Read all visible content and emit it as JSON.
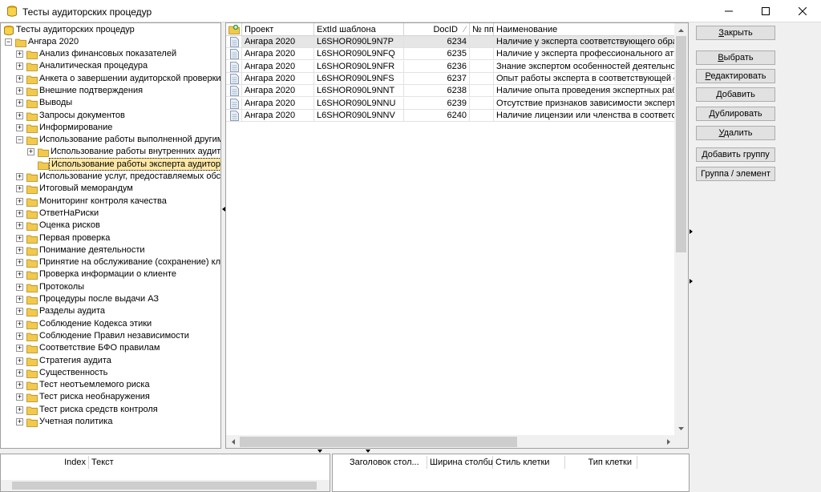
{
  "window": {
    "title": "Тесты аудиторских процедур",
    "icon": "database-icon",
    "controls": [
      "minimize-icon",
      "maximize-icon",
      "close-icon"
    ]
  },
  "tree": {
    "root": "Тесты аудиторских процедур",
    "project": "Ангара 2020",
    "nodes": [
      {
        "label": "Анализ финансовых показателей",
        "expander": "+"
      },
      {
        "label": "Аналитическая процедура",
        "expander": "+"
      },
      {
        "label": "Анкета о завершении аудиторской проверки",
        "expander": "+"
      },
      {
        "label": "Внешние подтверждения",
        "expander": "+"
      },
      {
        "label": "Выводы",
        "expander": "+"
      },
      {
        "label": "Запросы документов",
        "expander": "+"
      },
      {
        "label": "Информирование",
        "expander": "+"
      },
      {
        "label": "Использование работы выполненной другими",
        "expander": "−"
      },
      {
        "label": "Использование работы внутренних аудито...",
        "expander": "+",
        "child": true
      },
      {
        "label": "Использование работы эксперта аудитора",
        "expander": "",
        "child": true,
        "selected": true
      },
      {
        "label": "Использование услуг, предоставляемых обслу...",
        "expander": "+"
      },
      {
        "label": "Итоговый меморандум",
        "expander": "+"
      },
      {
        "label": "Мониторинг контроля качества",
        "expander": "+"
      },
      {
        "label": "ОтветНаРиски",
        "expander": "+"
      },
      {
        "label": "Оценка рисков",
        "expander": "+"
      },
      {
        "label": "Первая проверка",
        "expander": "+"
      },
      {
        "label": "Понимание деятельности",
        "expander": "+"
      },
      {
        "label": "Принятие на обслуживание (сохранение) клие...",
        "expander": "+"
      },
      {
        "label": "Проверка информации о клиенте",
        "expander": "+"
      },
      {
        "label": "Протоколы",
        "expander": "+"
      },
      {
        "label": "Процедуры после выдачи АЗ",
        "expander": "+"
      },
      {
        "label": "Разделы аудита",
        "expander": "+"
      },
      {
        "label": "Соблюдение Кодекса этики",
        "expander": "+"
      },
      {
        "label": "Соблюдение Правил независимости",
        "expander": "+"
      },
      {
        "label": "Соответствие БФО правилам",
        "expander": "+"
      },
      {
        "label": "Стратегия аудита",
        "expander": "+"
      },
      {
        "label": "Существенность",
        "expander": "+"
      },
      {
        "label": "Тест неотъемлемого риска",
        "expander": "+"
      },
      {
        "label": "Тест риска необнаружения",
        "expander": "+"
      },
      {
        "label": "Тест риска средств контроля",
        "expander": "+"
      },
      {
        "label": "Учетная политика",
        "expander": "+"
      }
    ]
  },
  "grid": {
    "columns": [
      "Проект",
      "ExtId шаблона",
      "DocID",
      "№ пп",
      "Наименование"
    ],
    "rows": [
      {
        "project": "Ангара 2020",
        "extid": "L6SHOR090L9N7P",
        "docid": "6234",
        "pp": "",
        "name": "Наличие у эксперта соответствующего образо..."
      },
      {
        "project": "Ангара 2020",
        "extid": "L6SHOR090L9NFQ",
        "docid": "6235",
        "pp": "",
        "name": "Наличие у эксперта профессионального аттес..."
      },
      {
        "project": "Ангара 2020",
        "extid": "L6SHOR090L9NFR",
        "docid": "6236",
        "pp": "",
        "name": "Знание экспертом особенностей деятельности ..."
      },
      {
        "project": "Ангара 2020",
        "extid": "L6SHOR090L9NFS",
        "docid": "6237",
        "pp": "",
        "name": "Опыт работы эксперта в соответствующей от..."
      },
      {
        "project": "Ангара 2020",
        "extid": "L6SHOR090L9NNT",
        "docid": "6238",
        "pp": "",
        "name": "Наличие опыта проведения экспертных работ ..."
      },
      {
        "project": "Ангара 2020",
        "extid": "L6SHOR090L9NNU",
        "docid": "6239",
        "pp": "",
        "name": "Отсутствие признаков зависимости эксперта о..."
      },
      {
        "project": "Ангара 2020",
        "extid": "L6SHOR090L9NNV",
        "docid": "6240",
        "pp": "",
        "name": "Наличие лицензии или членства в соответству..."
      }
    ]
  },
  "buttons": [
    {
      "label": "Закрыть",
      "key": "З",
      "rest": "акрыть"
    },
    {
      "label": "Выбрать",
      "key": "В",
      "rest": "ыбрать"
    },
    {
      "label": "Редактировать",
      "key": "Р",
      "rest": "едактировать"
    },
    {
      "label": "Добавить",
      "key": "Д",
      "rest": "обавить"
    },
    {
      "label": "Дублировать",
      "key": "Д",
      "rest": "ублировать"
    },
    {
      "label": "Удалить",
      "key": "У",
      "rest": "далить"
    },
    {
      "label": "Добавить группу",
      "key": "",
      "rest": "Добавить группу"
    },
    {
      "label": "Группа / элемент",
      "key": "",
      "rest": "Группа / элемент"
    }
  ],
  "bottom_left": {
    "columns": [
      "Index",
      "Текст"
    ]
  },
  "bottom_right": {
    "columns": [
      "Заголовок стол...",
      "Ширина столбца",
      "Стиль клетки",
      "Тип клетки"
    ]
  },
  "colors": {
    "selected_node": "#ffe8a6",
    "folder": "#f2c94c",
    "selected_row": "#e6e6e6"
  }
}
